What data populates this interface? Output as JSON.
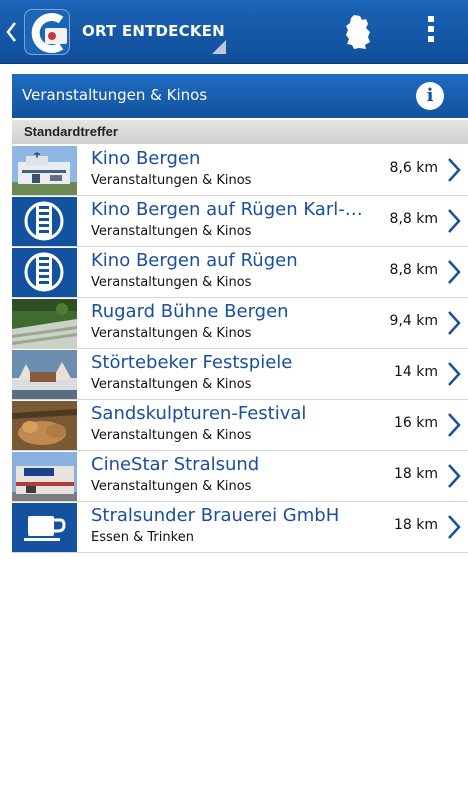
{
  "action_bar": {
    "title": "ORT ENTDECKEN",
    "back_icon": "chevron-left-icon",
    "map_icon": "germany-map-icon",
    "overflow_icon": "overflow-menu-icon"
  },
  "section": {
    "title": "Veranstaltungen & Kinos",
    "info_label": "i"
  },
  "group": {
    "label": "Standardtreffer"
  },
  "colors": {
    "brand_blue": "#13529f",
    "link_blue": "#1a4fa0"
  },
  "results": [
    {
      "name": "Kino Bergen",
      "category": "Veranstaltungen & Kinos",
      "distance": "8,6 km",
      "thumb": "photo-cinema-building"
    },
    {
      "name": "Kino Bergen auf Rügen Karl-Marx-Straße",
      "category": "Veranstaltungen & Kinos",
      "distance": "8,8 km",
      "thumb": "film-reel-icon"
    },
    {
      "name": "Kino Bergen auf Rügen",
      "category": "Veranstaltungen & Kinos",
      "distance": "8,8 km",
      "thumb": "film-reel-icon"
    },
    {
      "name": "Rugard Bühne Bergen",
      "category": "Veranstaltungen & Kinos",
      "distance": "9,4 km",
      "thumb": "photo-open-air-stage"
    },
    {
      "name": "Störtebeker Festspiele",
      "category": "Veranstaltungen & Kinos",
      "distance": "14 km",
      "thumb": "photo-festival-stage"
    },
    {
      "name": "Sandskulpturen-Festival",
      "category": "Veranstaltungen & Kinos",
      "distance": "16 km",
      "thumb": "photo-sand-sculpture"
    },
    {
      "name": "CineStar Stralsund",
      "category": "Veranstaltungen & Kinos",
      "distance": "18 km",
      "thumb": "photo-cinestar-building"
    },
    {
      "name": "Stralsunder Brauerei GmbH",
      "category": "Essen & Trinken",
      "distance": "18 km",
      "thumb": "coffee-cup-icon"
    }
  ]
}
